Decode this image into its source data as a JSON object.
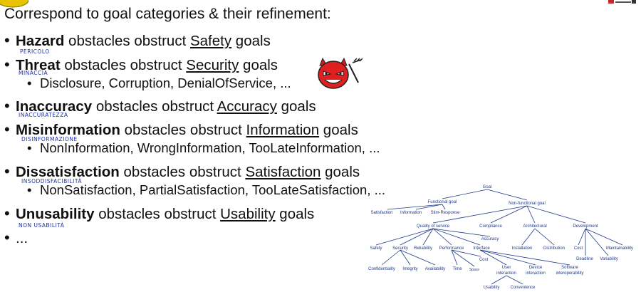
{
  "heading": "Correspond to goal categories & their refinement:",
  "bullets": [
    {
      "bold": "Hazard",
      "middle": " obstacles obstruct ",
      "underlined": "Safety",
      "tail": " goals"
    },
    {
      "bold": "Threat",
      "middle": " obstacles obstruct ",
      "underlined": "Security",
      "tail": " goals",
      "sub": "Disclosure, Corruption, DenialOfService, ..."
    },
    {
      "bold": "Inaccuracy",
      "middle": " obstacles obstruct ",
      "underlined": "Accuracy",
      "tail": " goals"
    },
    {
      "bold": "Misinformation",
      "middle": " obstacles obstruct ",
      "underlined": "Information",
      "tail": " goals",
      "sub": "NonInformation, WrongInformation, TooLateInformation, ..."
    },
    {
      "bold": "Dissatisfaction",
      "middle": " obstacles obstruct ",
      "underlined": "Satisfaction",
      "tail": " goals",
      "sub": "NonSatisfaction, PartialSatisfaction, TooLateSatisfaction, ..."
    },
    {
      "bold": "Unusability",
      "middle": " obstacles obstruct ",
      "underlined": "Usability",
      "tail": " goals"
    },
    {
      "plain": "..."
    }
  ],
  "handwritten": {
    "threat": "PERICOLO",
    "disclosure": "MINACCIA",
    "inaccuracy": "INACCURATEZZA",
    "misinformation": "DISINFORMAZIONE",
    "dissatisfaction": "INSODDISFACIBILITÀ",
    "unusability": "NON USABILITÀ"
  },
  "goal_tree": {
    "root": "Goal",
    "functional": "Functional goal",
    "satisfaction": "Satisfaction",
    "information": "Information",
    "stim_response": "Stim-Response",
    "non_functional": "Non-functional goal",
    "quality": "Quality of service",
    "compliance": "Compliance",
    "architectural": "Architectural",
    "development": "Development",
    "accuracy": "Accuracy",
    "safety": "Safety",
    "security": "Security",
    "reliability": "Reliability",
    "performance": "Performance",
    "interface": "Interface",
    "cost_perf": "Cost",
    "installation": "Installation",
    "distribution": "Distribution",
    "cost_dev": "Cost",
    "maintainability": "Maintainability",
    "deadline": "Deadline",
    "variability": "Variability",
    "confidentiality": "Confidentiality",
    "integrity": "Integrity",
    "availability": "Availability",
    "time": "Time",
    "space": "Space",
    "user_interaction_1": "User",
    "user_interaction_2": "interaction",
    "device_interaction_1": "Device",
    "device_interaction_2": "interaction",
    "software_interop_1": "Software",
    "software_interop_2": "interoperability",
    "usability": "Usability",
    "convenience": "Convenience"
  }
}
